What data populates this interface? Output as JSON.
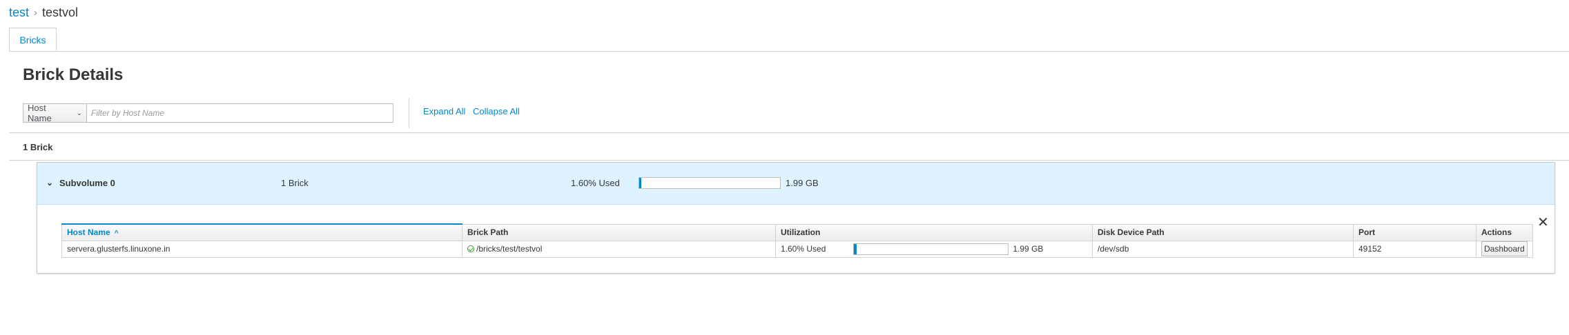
{
  "breadcrumb": {
    "parent": "test",
    "separator": "›",
    "current": "testvol"
  },
  "tabs": [
    {
      "label": "Bricks"
    }
  ],
  "page_title": "Brick Details",
  "filter": {
    "field_label": "Host Name",
    "placeholder": "Filter by Host Name"
  },
  "toolbar": {
    "expand_all": "Expand All",
    "collapse_all": "Collapse All"
  },
  "brick_count": "1 Brick",
  "subvolume": {
    "name": "Subvolume 0",
    "bricks": "1 Brick",
    "used_label": "1.60% Used",
    "used_fraction": 0.016,
    "total": "1.99 GB"
  },
  "table": {
    "columns": [
      "Host Name",
      "Brick Path",
      "Utilization",
      "Disk Device Path",
      "Port",
      "Actions"
    ],
    "sort_indicator": "^",
    "rows": [
      {
        "host": "servera.glusterfs.linuxone.in",
        "path": "/bricks/test/testvol",
        "used_label": "1.60% Used",
        "used_fraction": 0.016,
        "total": "1.99 GB",
        "device": "/dev/sdb",
        "port": "49152",
        "action": "Dashboard"
      }
    ]
  },
  "icons": {
    "close": "close-icon",
    "chevron": "chevron-down-icon",
    "status": "status-ok-icon"
  },
  "colors": {
    "accent": "#0088ce",
    "header_bg": "#def3ff",
    "ok": "#3f9c35"
  }
}
